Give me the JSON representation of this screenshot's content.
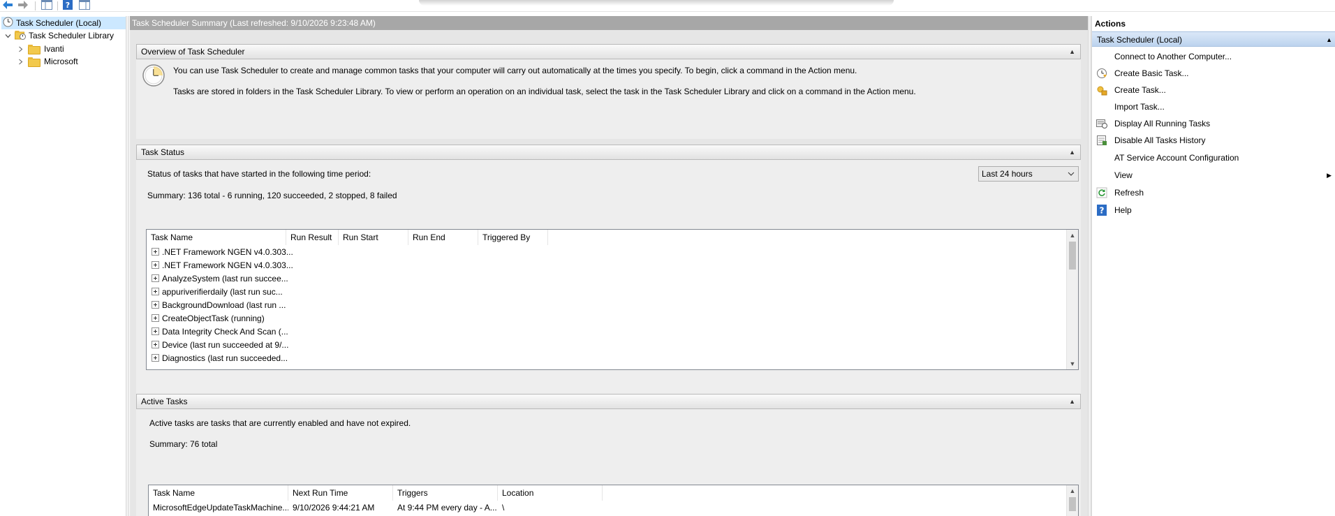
{
  "toolbar": {
    "icons": [
      "back-arrow-icon",
      "forward-arrow-icon",
      "show-hide-console-tree-icon",
      "help-icon",
      "properties-icon"
    ]
  },
  "tree": {
    "root": "Task Scheduler (Local)",
    "library": "Task Scheduler Library",
    "folders": [
      "Ivanti",
      "Microsoft"
    ]
  },
  "center": {
    "title": "Task Scheduler Summary (Last refreshed: 9/10/2026 9:23:48 AM)",
    "overview": {
      "header": "Overview of Task Scheduler",
      "line1": "You can use Task Scheduler to create and manage common tasks that your computer will carry out automatically at the times you specify. To begin, click a command in the Action menu.",
      "line2": "Tasks are stored in folders in the Task Scheduler Library. To view or perform an operation on an individual task, select the task in the Task Scheduler Library and click on a command in the Action menu."
    },
    "status": {
      "header": "Task Status",
      "period_label": "Status of tasks that have started in the following time period:",
      "period_value": "Last 24 hours",
      "summary": "Summary: 136 total - 6 running, 120 succeeded, 2 stopped, 8 failed",
      "columns": [
        "Task Name",
        "Run Result",
        "Run Start",
        "Run End",
        "Triggered By"
      ],
      "rows": [
        ".NET Framework NGEN v4.0.303...",
        ".NET Framework NGEN v4.0.303...",
        "AnalyzeSystem (last run succee...",
        "appuriverifierdaily (last run suc...",
        "BackgroundDownload (last run ...",
        "CreateObjectTask (running)",
        "Data Integrity Check And Scan (...",
        "Device (last run succeeded at 9/...",
        "Diagnostics (last run succeeded..."
      ]
    },
    "active": {
      "header": "Active Tasks",
      "description": "Active tasks are tasks that are currently enabled and have not expired.",
      "summary": "Summary: 76 total",
      "columns": [
        "Task Name",
        "Next Run Time",
        "Triggers",
        "Location"
      ],
      "rows": [
        {
          "name": "MicrosoftEdgeUpdateTaskMachine...",
          "next": "9/10/2026 9:44:21 AM",
          "triggers": "At 9:44 PM every day - A...",
          "location": "\\"
        }
      ]
    }
  },
  "actions": {
    "title": "Actions",
    "group": "Task Scheduler (Local)",
    "items": [
      {
        "label": "Connect to Another Computer...",
        "icon": ""
      },
      {
        "label": "Create Basic Task...",
        "icon": "create-basic-task-icon"
      },
      {
        "label": "Create Task...",
        "icon": "create-task-icon"
      },
      {
        "label": "Import Task...",
        "icon": ""
      },
      {
        "label": "Display All Running Tasks",
        "icon": "display-running-tasks-icon"
      },
      {
        "label": "Disable All Tasks History",
        "icon": "disable-history-icon"
      },
      {
        "label": "AT Service Account Configuration",
        "icon": ""
      },
      {
        "label": "View",
        "icon": ""
      },
      {
        "label": "Refresh",
        "icon": "refresh-icon"
      },
      {
        "label": "Help",
        "icon": "help-icon"
      }
    ]
  },
  "colors": {
    "selection": "#cce8ff",
    "title_bar": "#a7a7a7",
    "actions_group": "#bcd3ee",
    "help_blue": "#2b6cc4"
  }
}
